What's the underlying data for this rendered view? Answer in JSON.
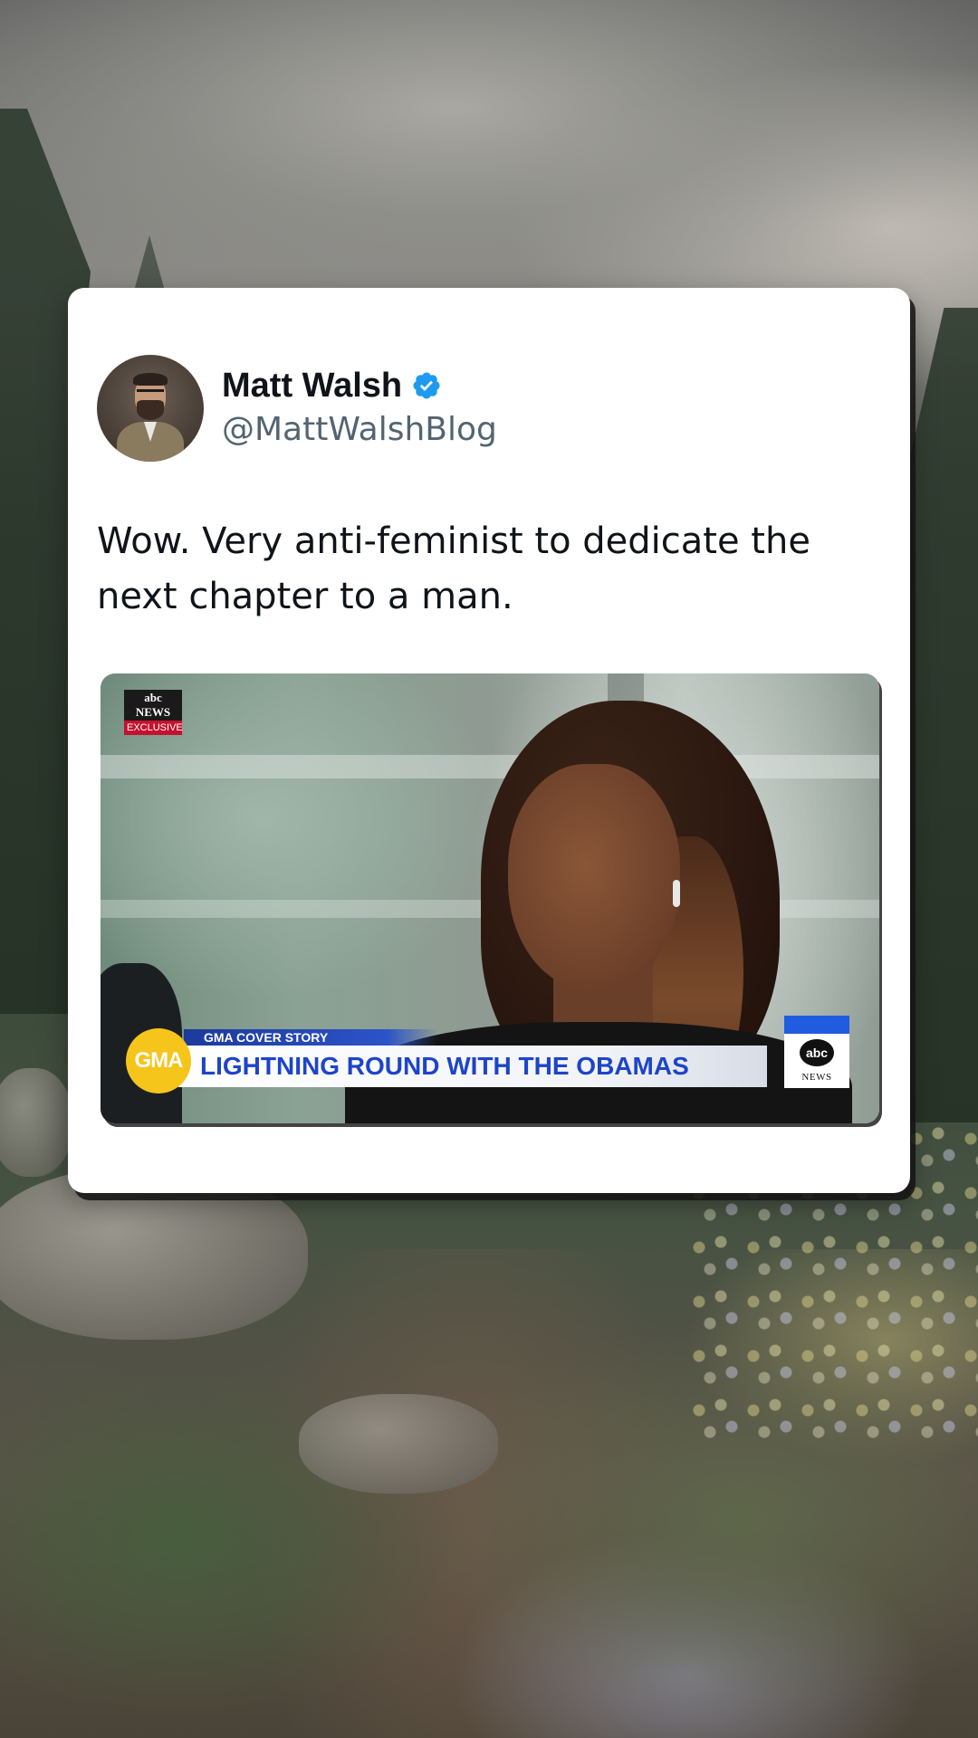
{
  "tweet": {
    "author": {
      "display_name": "Matt Walsh",
      "handle": "@MattWalshBlog",
      "verified": true,
      "verified_color": "#1d9bf0"
    },
    "text": "Wow. Very anti-feminist to dedicate the next chapter to a man."
  },
  "video": {
    "corner_logo_top": "abc NEWS",
    "corner_logo_bottom": "EXCLUSIVE",
    "show_badge": "GMA",
    "segment_label": "GMA COVER STORY",
    "headline": "LIGHTNING ROUND WITH THE OBAMAS",
    "network_bug_logo": "abc",
    "network_bug_label": "NEWS",
    "colors": {
      "headline_blue": "#1d44c9",
      "gma_yellow": "#f5c51c"
    }
  }
}
